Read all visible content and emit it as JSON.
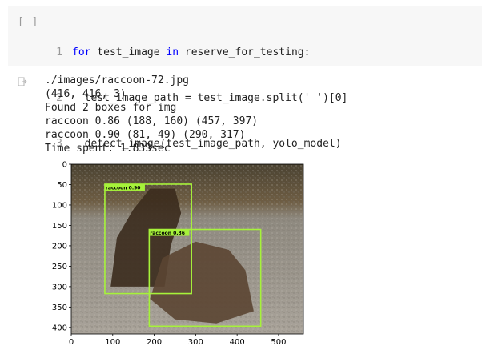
{
  "cell": {
    "run_button": "[ ]",
    "code_lines": [
      {
        "num": "1",
        "kw1": "for",
        "t1": " test_image ",
        "kw2": "in",
        "t2": " reserve_for_testing:"
      },
      {
        "num": "2",
        "text": "  test_image_path = test_image.split(' ')[0]"
      },
      {
        "num": "3",
        "text": "  detect_image(test_image_path, yolo_model)"
      }
    ]
  },
  "output": {
    "icon": "output-arrow-icon",
    "lines": [
      "./images/raccoon-72.jpg",
      "(416, 416, 3)",
      "Found 2 boxes for img",
      "raccoon 0.86 (188, 160) (457, 397)",
      "raccoon 0.90 (81, 49) (290, 317)",
      "Time spent: 1.833sec"
    ]
  },
  "chart_data": {
    "type": "image",
    "image_size": [
      560,
      416
    ],
    "xticks": [
      "0",
      "100",
      "200",
      "300",
      "400",
      "500"
    ],
    "yticks": [
      "0",
      "50",
      "100",
      "150",
      "200",
      "250",
      "300",
      "350",
      "400"
    ],
    "boxes": [
      {
        "label": "raccoon 0.90",
        "x1": 81,
        "y1": 49,
        "x2": 290,
        "y2": 317
      },
      {
        "label": "raccoon 0.86",
        "x1": 188,
        "y1": 160,
        "x2": 457,
        "y2": 397
      }
    ],
    "box_color": "#a6f23a"
  }
}
